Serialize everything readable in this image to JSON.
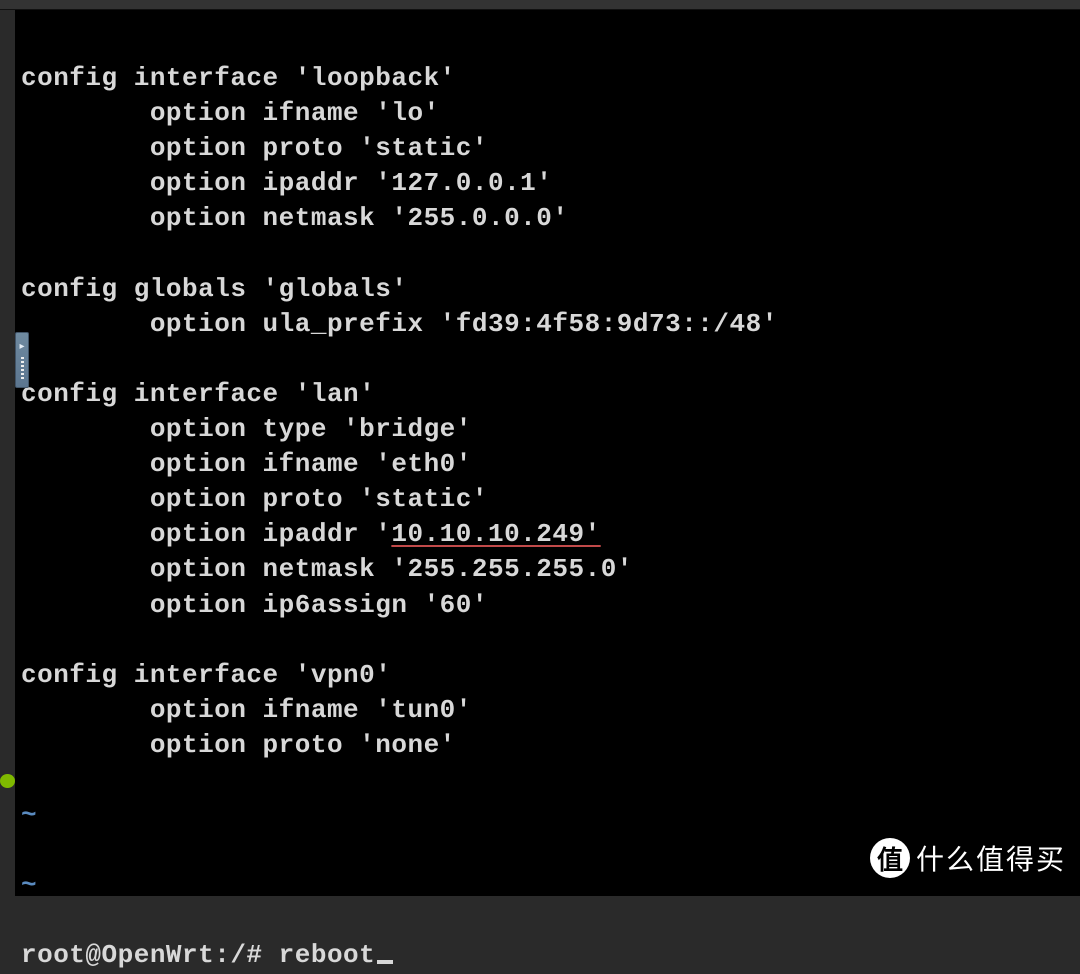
{
  "config": {
    "loopback": {
      "header": "config interface 'loopback'",
      "ifname": "        option ifname 'lo'",
      "proto": "        option proto 'static'",
      "ipaddr": "        option ipaddr '127.0.0.1'",
      "netmask": "        option netmask '255.0.0.0'"
    },
    "globals": {
      "header": "config globals 'globals'",
      "ula": "        option ula_prefix 'fd39:4f58:9d73::/48'"
    },
    "lan": {
      "header": "config interface 'lan'",
      "type": "        option type 'bridge'",
      "ifname": "        option ifname 'eth0'",
      "proto": "        option proto 'static'",
      "ipaddr_pre": "        option ipaddr '",
      "ipaddr_val": "10.10.10.249'",
      "netmask": "        option netmask '255.255.255.0'",
      "ip6": "        option ip6assign '60'"
    },
    "vpn0": {
      "header": "config interface 'vpn0'",
      "ifname": "        option ifname 'tun0'",
      "proto": "        option proto 'none'"
    }
  },
  "tilde": "~",
  "prompt_line": "root@OpenWrt:/# reboot",
  "watermark": {
    "circle": "值",
    "text": "什么值得买"
  }
}
